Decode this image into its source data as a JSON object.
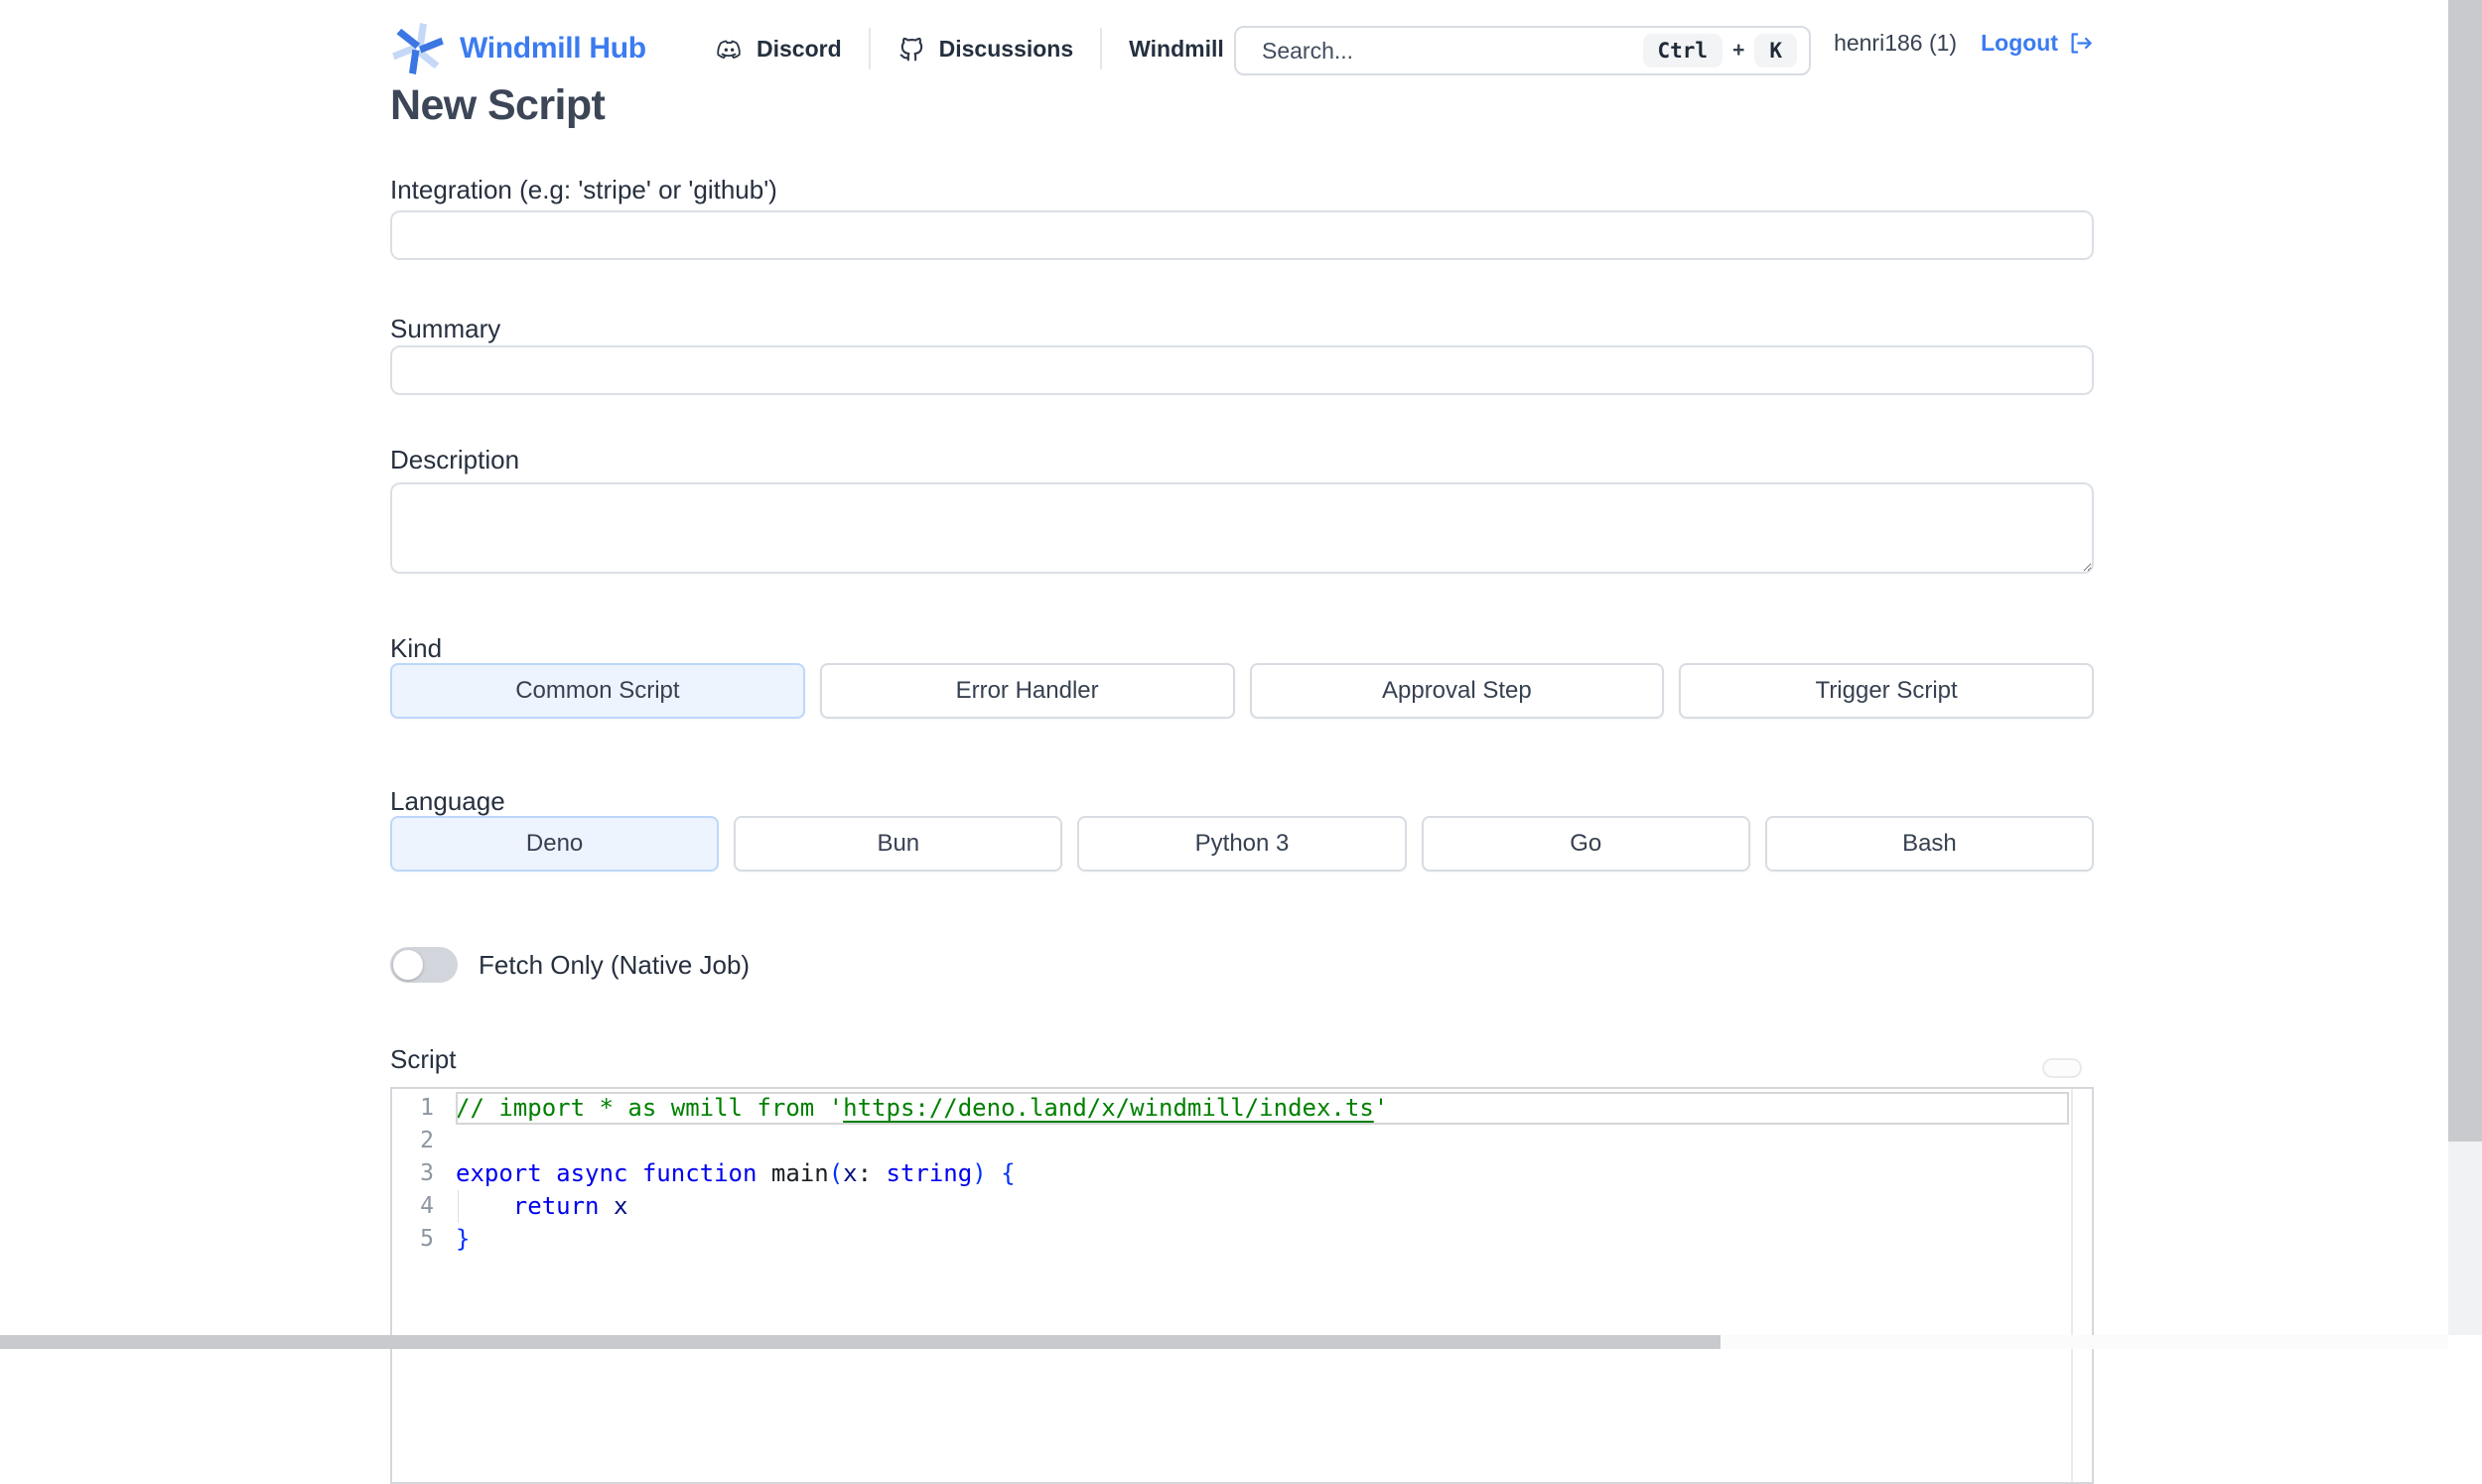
{
  "header": {
    "brand": "Windmill Hub",
    "logo_icon": "windmill-logo-icon",
    "nav": [
      {
        "label": "Discord",
        "icon": "discord-icon"
      },
      {
        "label": "Discussions",
        "icon": "github-icon"
      },
      {
        "label": "Windmill",
        "icon": null
      }
    ],
    "search": {
      "placeholder": "Search...",
      "keys": [
        "Ctrl",
        "K"
      ],
      "key_separator": "+"
    },
    "user": "henri186 (1)",
    "logout_label": "Logout",
    "logout_icon": "logout-icon"
  },
  "page": {
    "title": "New Script"
  },
  "form": {
    "integration": {
      "label": "Integration (e.g: 'stripe' or 'github')",
      "value": ""
    },
    "summary": {
      "label": "Summary",
      "value": ""
    },
    "description": {
      "label": "Description",
      "value": ""
    },
    "kind": {
      "label": "Kind",
      "options": [
        "Common Script",
        "Error Handler",
        "Approval Step",
        "Trigger Script"
      ],
      "selected": "Common Script"
    },
    "language": {
      "label": "Language",
      "options": [
        "Deno",
        "Bun",
        "Python 3",
        "Go",
        "Bash"
      ],
      "selected": "Deno"
    },
    "fetch_only": {
      "label": "Fetch Only (Native Job)",
      "enabled": false
    },
    "script_label": "Script"
  },
  "editor": {
    "lines": [
      {
        "n": "1",
        "current": true,
        "tokens": [
          {
            "t": "// import * as wmill from '",
            "c": "comment"
          },
          {
            "t": "https://deno.land/x/windmill/index.ts",
            "c": "comment-link"
          },
          {
            "t": "'",
            "c": "comment"
          }
        ]
      },
      {
        "n": "2",
        "tokens": []
      },
      {
        "n": "3",
        "tokens": [
          {
            "t": "export async function",
            "c": "keyword"
          },
          {
            "t": " main",
            "c": "plain"
          },
          {
            "t": "(",
            "c": "bracket"
          },
          {
            "t": "x",
            "c": "param"
          },
          {
            "t": ": ",
            "c": "plain"
          },
          {
            "t": "string",
            "c": "keyword"
          },
          {
            "t": ")",
            "c": "bracket"
          },
          {
            "t": " ",
            "c": "plain"
          },
          {
            "t": "{",
            "c": "bracket"
          }
        ]
      },
      {
        "n": "4",
        "indent_guide": true,
        "tokens": [
          {
            "t": "    ",
            "c": "plain"
          },
          {
            "t": "return",
            "c": "keyword"
          },
          {
            "t": " x",
            "c": "param"
          }
        ]
      },
      {
        "n": "5",
        "tokens": [
          {
            "t": "}",
            "c": "bracket"
          }
        ]
      }
    ]
  },
  "colors": {
    "accent": "#3b7bf0",
    "selected_bg": "#edf4fe",
    "selected_border": "#bcd7fb",
    "comment_green": "#008000",
    "keyword_blue": "#0000f0",
    "bracket_blue": "#0431fa",
    "scrollbar_thumb": "#c8cacd"
  }
}
